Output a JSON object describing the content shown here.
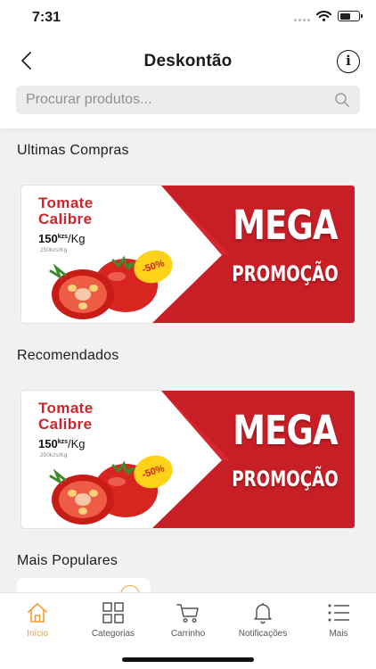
{
  "status_bar": {
    "time": "7:31",
    "battery_level": 0.55
  },
  "header": {
    "title": "Deskontão"
  },
  "search": {
    "placeholder": "Procurar produtos..."
  },
  "sections": [
    {
      "title": "Ultimas Compras",
      "banner": {
        "product_line1": "Tomate",
        "product_line2": "Calibre",
        "price": "150",
        "currency": "kzs",
        "unit": "/Kg",
        "old_price": "250kzs/Kg",
        "discount": "-50%",
        "headline": "MEGA",
        "subheadline": "PROMOÇÃO"
      }
    },
    {
      "title": "Recomendados",
      "banner": {
        "product_line1": "Tomate",
        "product_line2": "Calibre",
        "price": "150",
        "currency": "kzs",
        "unit": "/Kg",
        "old_price": "250kzs/Kg",
        "discount": "-50%",
        "headline": "MEGA",
        "subheadline": "PROMOÇÃO"
      }
    },
    {
      "title": "Mais Populares"
    }
  ],
  "tabbar": {
    "active_index": 0,
    "items": [
      {
        "label": "Início",
        "icon": "home-icon"
      },
      {
        "label": "Categorias",
        "icon": "grid-icon"
      },
      {
        "label": "Carrinho",
        "icon": "cart-icon"
      },
      {
        "label": "Notificações",
        "icon": "bell-icon"
      },
      {
        "label": "Mais",
        "icon": "list-icon"
      }
    ]
  },
  "colors": {
    "accent": "#f0a030",
    "promo_red": "#d2232a",
    "discount_yellow": "#ffd21a"
  }
}
